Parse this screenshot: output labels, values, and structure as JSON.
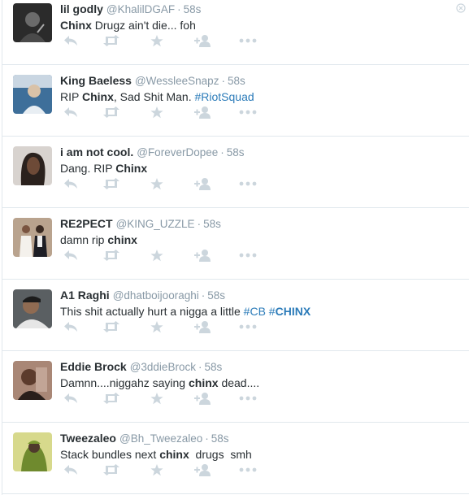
{
  "colors": {
    "muted": "#8899a6",
    "icon": "#ccd6dd",
    "link": "#2b7bb9",
    "divider": "#e1e8ed"
  },
  "icons": [
    "reply-icon",
    "retweet-icon",
    "favorite-icon",
    "follow-icon",
    "more-icon",
    "dismiss-icon"
  ],
  "tweets": [
    {
      "name": "lil godly",
      "handle": "@KhalilDGAF",
      "sep": "·",
      "time": "58s",
      "segments": [
        {
          "t": "Chinx",
          "s": "b"
        },
        {
          "t": " Drugz ain't die... foh",
          "s": ""
        }
      ]
    },
    {
      "name": "King Baeless",
      "handle": "@WessleeSnapz",
      "sep": "·",
      "time": "58s",
      "segments": [
        {
          "t": "RIP ",
          "s": ""
        },
        {
          "t": "Chinx",
          "s": "b"
        },
        {
          "t": ", Sad Shit Man. ",
          "s": ""
        },
        {
          "t": "#RiotSquad",
          "s": "tag"
        }
      ]
    },
    {
      "name": "i am not cool.",
      "handle": "@ForeverDopee",
      "sep": "·",
      "time": "58s",
      "segments": [
        {
          "t": "Dang. RIP ",
          "s": ""
        },
        {
          "t": "Chinx",
          "s": "b"
        }
      ]
    },
    {
      "name": "RE2PECT",
      "handle": "@KING_UZZLE",
      "sep": "·",
      "time": "58s",
      "segments": [
        {
          "t": "damn rip ",
          "s": ""
        },
        {
          "t": "chinx",
          "s": "b"
        }
      ]
    },
    {
      "name": "A1 Raghi",
      "handle": "@dhatboijooraghi",
      "sep": "·",
      "time": "58s",
      "segments": [
        {
          "t": "This shit actually hurt a nigga a little ",
          "s": ""
        },
        {
          "t": "#CB",
          "s": "tag"
        },
        {
          "t": " ",
          "s": ""
        },
        {
          "t": "#",
          "s": "tag"
        },
        {
          "t": "CHINX",
          "s": "tagb"
        }
      ]
    },
    {
      "name": "Eddie Brock",
      "handle": "@3ddieBrock",
      "sep": "·",
      "time": "58s",
      "segments": [
        {
          "t": "Damnn....niggahz saying ",
          "s": ""
        },
        {
          "t": "chinx",
          "s": "b"
        },
        {
          "t": " dead....",
          "s": ""
        }
      ]
    },
    {
      "name": "Tweezaleo",
      "handle": "@Bh_Tweezaleo",
      "sep": "·",
      "time": "58s",
      "segments": [
        {
          "t": "Stack bundles next ",
          "s": ""
        },
        {
          "t": "chinx",
          "s": "b"
        },
        {
          "t": "  drugs  smh",
          "s": ""
        }
      ]
    }
  ]
}
